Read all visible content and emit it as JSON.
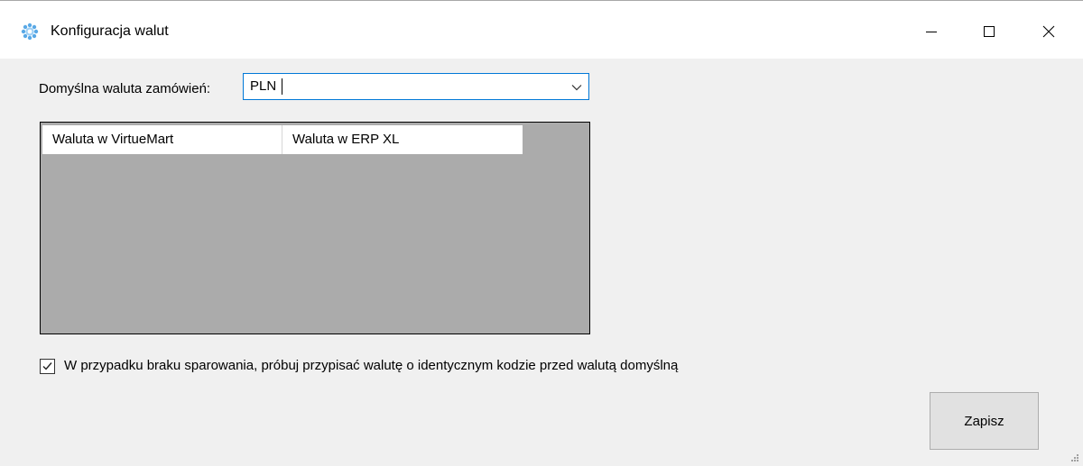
{
  "window": {
    "title": "Konfiguracja walut",
    "icon": "gear-flower-icon"
  },
  "form": {
    "default_currency_label": "Domyślna waluta zamówień:",
    "default_currency_value": "PLN"
  },
  "grid": {
    "columns": [
      "Waluta w VirtueMart",
      "Waluta w ERP XL"
    ],
    "rows": []
  },
  "options": {
    "match_code_checked": true,
    "match_code_label": "W przypadku braku sparowania, próbuj przypisać walutę o identycznym kodzie przed walutą domyślną"
  },
  "actions": {
    "save_label": "Zapisz"
  },
  "colors": {
    "focus_border": "#0078d7",
    "grid_background": "#ababab",
    "window_background": "#f0f0f0",
    "button_face": "#e1e1e1"
  }
}
